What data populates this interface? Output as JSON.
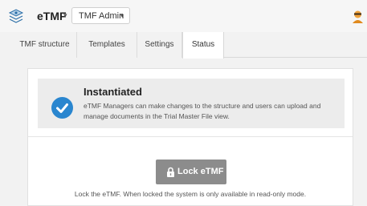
{
  "header": {
    "app_icon": "stack-layers-icon",
    "app_name": "eTMF",
    "app_caret": "▾",
    "context_selector": {
      "value": "TMF Admin",
      "caret": "▾"
    },
    "user_icon": "user-avatar-icon"
  },
  "tabs": [
    {
      "label": "TMF structure",
      "active": false
    },
    {
      "label": "Templates",
      "active": false
    },
    {
      "label": "Settings",
      "active": false
    },
    {
      "label": "Status",
      "active": true
    }
  ],
  "status": {
    "icon": "check-circle-icon",
    "title": "Instantiated",
    "description": "eTMF Managers can make changes to the structure and users can upload and manage documents in the Trial Master File view.",
    "accent_color": "#2a86cf"
  },
  "lock": {
    "icon": "lock-icon",
    "button_label": "Lock eTMF",
    "hint": "Lock the eTMF. When locked the system is only available in read-only mode.",
    "button_color": "#8c8c8c"
  }
}
